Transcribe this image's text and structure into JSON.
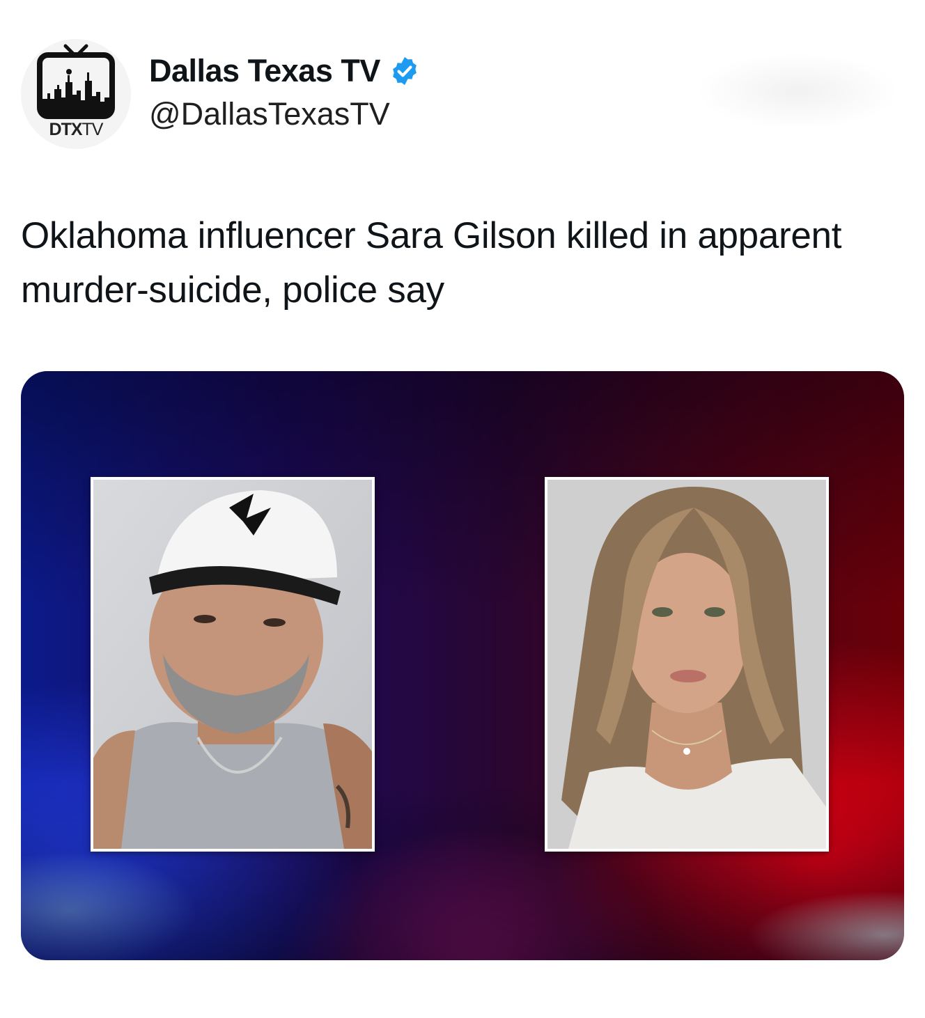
{
  "account": {
    "display_name": "Dallas Texas TV",
    "handle": "@DallasTexasTV",
    "verified": true,
    "verified_badge_color": "#1d9bf0",
    "avatar_logo_text": "DTXTV"
  },
  "tweet": {
    "text": "Oklahoma influencer Sara Gilson killed in apparent murder-suicide, police say"
  },
  "media": {
    "background": "police lights blue and red",
    "blue_color": "#2a4cff",
    "red_color": "#ff1020",
    "photos": [
      {
        "subject": "man in white cap"
      },
      {
        "subject": "woman with long hair"
      }
    ]
  }
}
